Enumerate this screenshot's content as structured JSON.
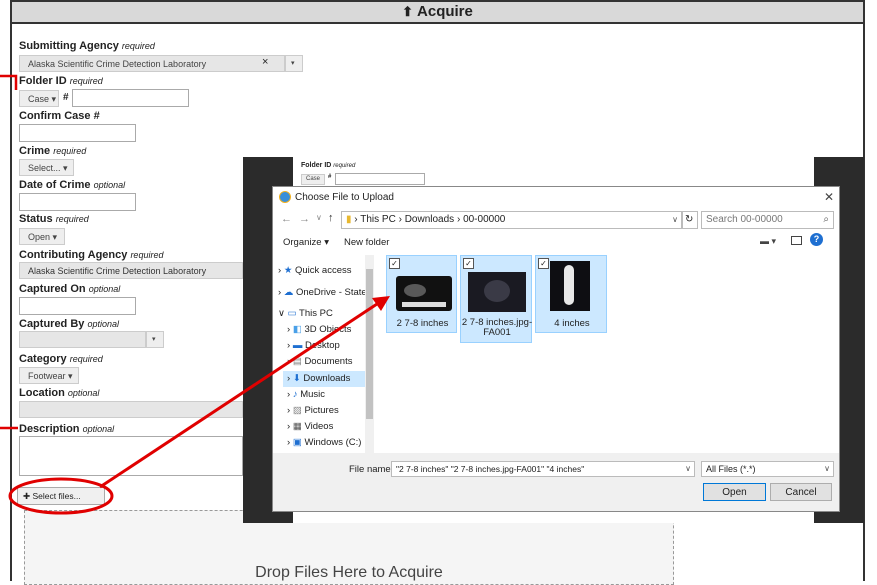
{
  "header": {
    "title": "Acquire",
    "icon": "upload-icon"
  },
  "form": {
    "submitting_agency": {
      "label": "Submitting Agency",
      "hint": "required",
      "value": "Alaska Scientific Crime Detection Laboratory",
      "clear": "×"
    },
    "folder_id": {
      "label": "Folder ID",
      "hint": "required",
      "type": "Case",
      "hash": "#"
    },
    "confirm_case": {
      "label": "Confirm Case #"
    },
    "crime": {
      "label": "Crime",
      "hint": "required",
      "value": "Select..."
    },
    "date_of_crime": {
      "label": "Date of Crime",
      "hint": "optional"
    },
    "status": {
      "label": "Status",
      "hint": "required",
      "value": "Open"
    },
    "contributing_agency": {
      "label": "Contributing Agency",
      "hint": "required",
      "value": "Alaska Scientific Crime Detection Laboratory"
    },
    "captured_on": {
      "label": "Captured On",
      "hint": "optional"
    },
    "captured_by": {
      "label": "Captured By",
      "hint": "optional"
    },
    "category": {
      "label": "Category",
      "hint": "required",
      "value": "Footwear"
    },
    "location": {
      "label": "Location",
      "hint": "optional"
    },
    "description": {
      "label": "Description",
      "hint": "optional"
    },
    "select_files": "Select files...",
    "drop_zone": "Drop Files Here to Acquire"
  },
  "bg_window": {
    "folder_label": "Folder ID",
    "folder_hint": "required",
    "type": "Case",
    "hash": "#"
  },
  "dialog": {
    "title": "Choose File to Upload",
    "path": [
      "This PC",
      "Downloads",
      "00-00000"
    ],
    "search_placeholder": "Search 00-00000",
    "organize": "Organize",
    "new_folder": "New folder",
    "tree": [
      "Quick access",
      "OneDrive - State",
      "This PC",
      "3D Objects",
      "Desktop",
      "Documents",
      "Downloads",
      "Music",
      "Pictures",
      "Videos",
      "Windows (C:)"
    ],
    "files": [
      "2 7-8 inches",
      "2 7-8 inches.jpg-FA001",
      "4 inches"
    ],
    "file_name_label": "File name:",
    "file_name_value": "\"2 7-8 inches\" \"2 7-8 inches.jpg-FA001\" \"4 inches\"",
    "file_type": "All Files (*.*)",
    "open": "Open",
    "cancel": "Cancel"
  },
  "colors": {
    "annotation": "#e00000",
    "header_bg": "#d9d9d9",
    "selection": "#cce8ff"
  }
}
